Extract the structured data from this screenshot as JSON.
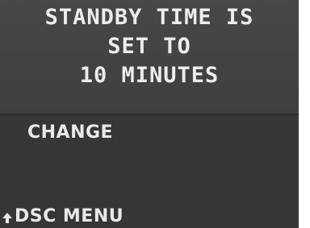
{
  "message": {
    "line1": "STANDBY TIME IS",
    "line2": "SET TO",
    "line3": "10 MINUTES"
  },
  "menu": {
    "option": "CHANGE"
  },
  "navigation": {
    "back_label": "DSC MENU",
    "back_icon": "return-arrow-icon"
  },
  "colors": {
    "screen_background": "#3a3a3a",
    "text": "#ececec"
  }
}
